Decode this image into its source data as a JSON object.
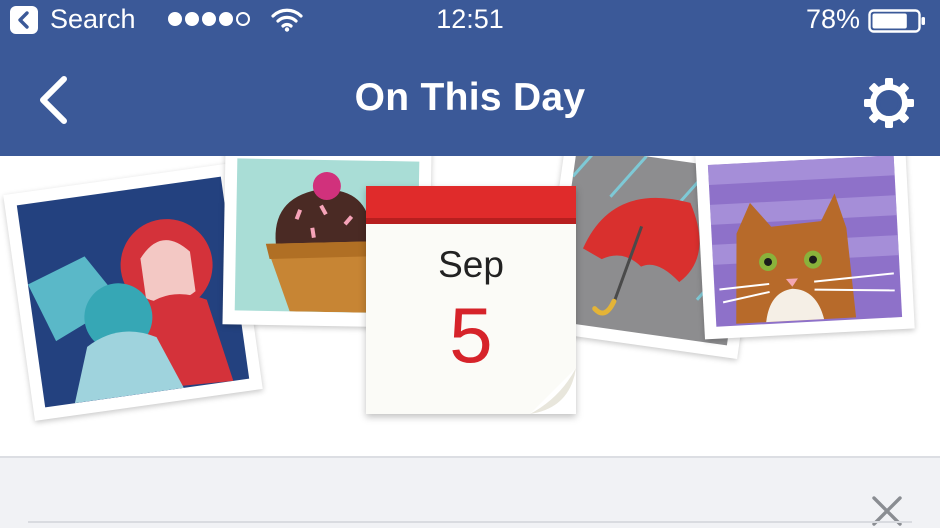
{
  "status_bar": {
    "back_app_label": "Search",
    "signal_bars_filled": 4,
    "signal_bars_total": 5,
    "time": "12:51",
    "battery_percent": "78%",
    "battery_level": 0.78
  },
  "nav_bar": {
    "title": "On This Day",
    "back_icon": "chevron-left-icon",
    "settings_icon": "gear-icon"
  },
  "hero": {
    "calendar_month": "Sep",
    "calendar_day": "5"
  },
  "panel": {
    "close_icon": "close-icon"
  },
  "colors": {
    "facebook_blue": "#3b5998",
    "calendar_red": "#e02b2b",
    "day_red": "#d6232a",
    "panel_bg": "#f1f2f5"
  }
}
